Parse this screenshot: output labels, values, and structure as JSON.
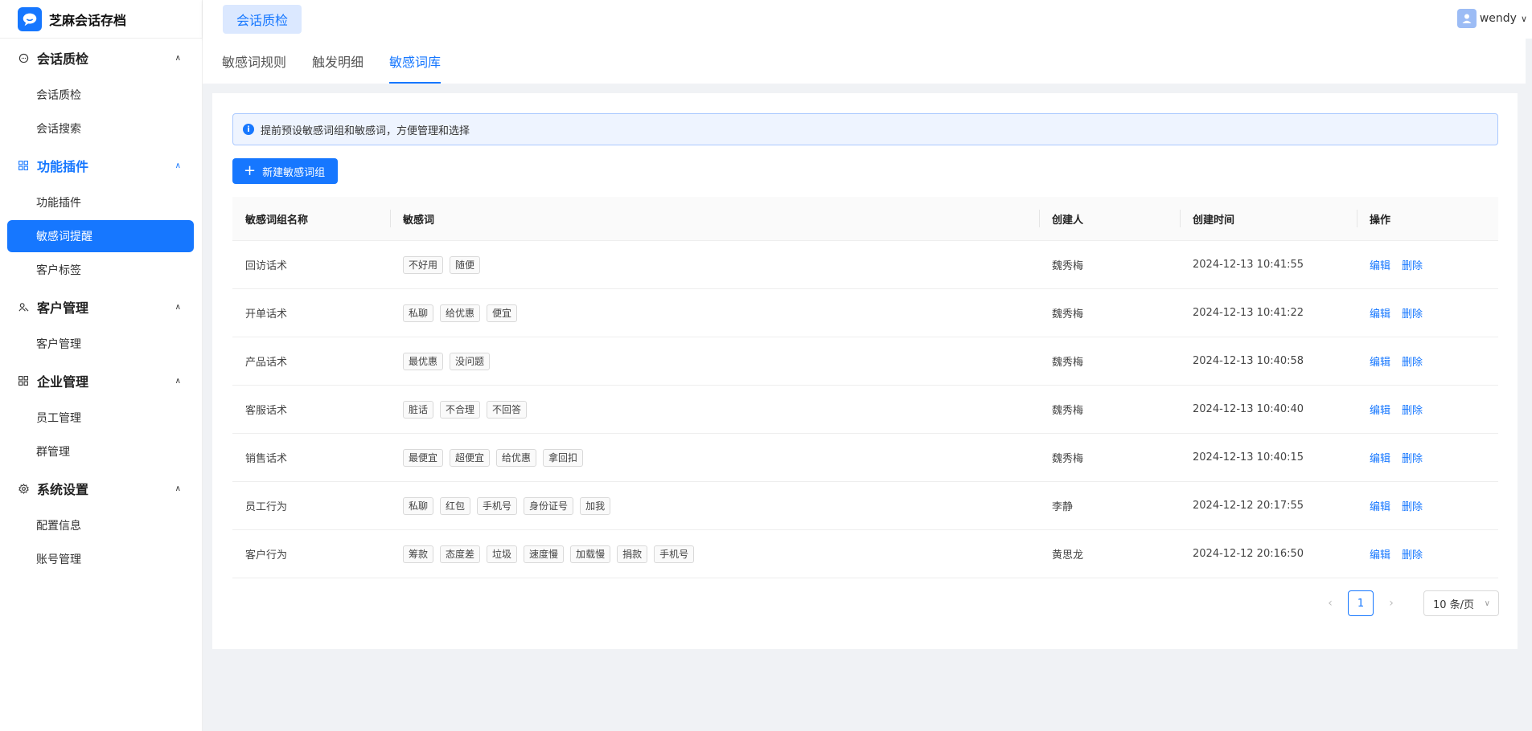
{
  "app": {
    "name": "芝麻会话存档"
  },
  "sidebar": {
    "groups": [
      {
        "label": "会话质检",
        "icon": "chat-icon",
        "items": [
          "会话质检",
          "会话搜索"
        ]
      },
      {
        "label": "功能插件",
        "icon": "grid-icon",
        "items": [
          "功能插件",
          "敏感词提醒",
          "客户标签"
        ]
      },
      {
        "label": "客户管理",
        "icon": "users-icon",
        "items": [
          "客户管理"
        ]
      },
      {
        "label": "企业管理",
        "icon": "grid-icon",
        "items": [
          "员工管理",
          "群管理"
        ]
      },
      {
        "label": "系统设置",
        "icon": "gear-icon",
        "items": [
          "配置信息",
          "账号管理"
        ]
      }
    ],
    "active_group": "功能插件",
    "active_item": "敏感词提醒"
  },
  "header": {
    "tab": "会话质检",
    "user": "wendy"
  },
  "subtabs": [
    "敏感词规则",
    "触发明细",
    "敏感词库"
  ],
  "active_subtab": "敏感词库",
  "alert": {
    "text": "提前预设敏感词组和敏感词，方便管理和选择"
  },
  "add_button": "新建敏感词组",
  "table": {
    "columns": [
      "敏感词组名称",
      "敏感词",
      "创建人",
      "创建时间",
      "操作"
    ],
    "rows": [
      {
        "name": "回访话术",
        "words": [
          "不好用",
          "随便"
        ],
        "creator": "魏秀梅",
        "time": "2024-12-13 10:41:55"
      },
      {
        "name": "开单话术",
        "words": [
          "私聊",
          "给优惠",
          "便宜"
        ],
        "creator": "魏秀梅",
        "time": "2024-12-13 10:41:22"
      },
      {
        "name": "产品话术",
        "words": [
          "最优惠",
          "没问题"
        ],
        "creator": "魏秀梅",
        "time": "2024-12-13 10:40:58"
      },
      {
        "name": "客服话术",
        "words": [
          "脏话",
          "不合理",
          "不回答"
        ],
        "creator": "魏秀梅",
        "time": "2024-12-13 10:40:40"
      },
      {
        "name": "销售话术",
        "words": [
          "最便宜",
          "超便宜",
          "给优惠",
          "拿回扣"
        ],
        "creator": "魏秀梅",
        "time": "2024-12-13 10:40:15"
      },
      {
        "name": "员工行为",
        "words": [
          "私聊",
          "红包",
          "手机号",
          "身份证号",
          "加我"
        ],
        "creator": "李静",
        "time": "2024-12-12 20:17:55"
      },
      {
        "name": "客户行为",
        "words": [
          "筹款",
          "态度差",
          "垃圾",
          "速度慢",
          "加载慢",
          "捐款",
          "手机号"
        ],
        "creator": "黄思龙",
        "time": "2024-12-12 20:16:50"
      }
    ],
    "actions": {
      "edit": "编辑",
      "delete": "删除"
    }
  },
  "pagination": {
    "current": "1",
    "page_size": "10 条/页"
  },
  "colors": {
    "accent": "#1677ff",
    "background": "#f0f2f5"
  }
}
